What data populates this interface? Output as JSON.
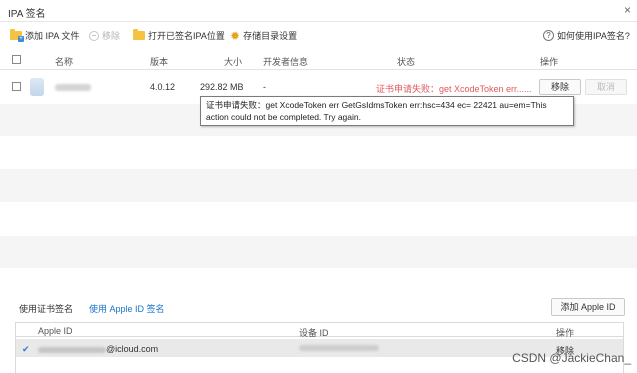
{
  "window": {
    "title": "IPA 签名",
    "close_glyph": "×"
  },
  "toolbar": {
    "add_ipa": "添加 IPA 文件",
    "remove": "移除",
    "open_signed": "打开已签名IPA位置",
    "storage_settings": "存储目录设置",
    "help": "如何使用IPA签名?"
  },
  "table": {
    "headers": {
      "name": "名称",
      "version": "版本",
      "size": "大小",
      "developer": "开发者信息",
      "status": "状态",
      "action": "操作"
    },
    "rows": [
      {
        "version": "4.0.12",
        "size": "292.82 MB",
        "developer": "-",
        "status": "证书申请失败：get XcodeToken err......",
        "remove_label": "移除",
        "cancel_label": "取消"
      }
    ]
  },
  "tooltip": {
    "text": "证书申请失败：get XcodeToken err GetGsIdmsToken err:hsc=434 ec= 22421 au=em=This action could not be completed. Try again."
  },
  "bottom": {
    "tab_cert": "使用证书签名",
    "tab_apple_id": "使用 Apple ID 签名",
    "add_apple_id": "添加 Apple ID",
    "headers": {
      "apple_id": "Apple ID",
      "device_id": "设备 ID",
      "action": "操作"
    },
    "rows": [
      {
        "check": "✔",
        "email_suffix": "@icloud.com",
        "action": "移除"
      }
    ]
  },
  "watermark": "CSDN @JackieChan_",
  "colors": {
    "accent": "#1a73c8",
    "error": "#e05a5a",
    "folder": "#f5c342"
  }
}
